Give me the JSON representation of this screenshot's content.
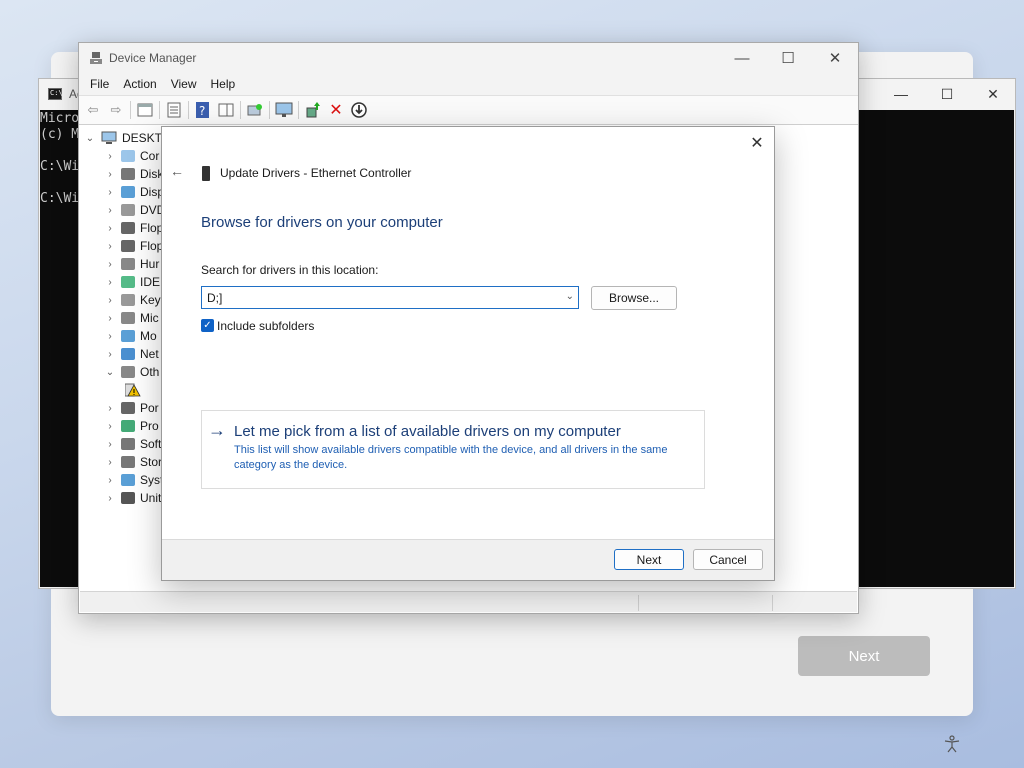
{
  "setup": {
    "next_label": "Next"
  },
  "console": {
    "title": "Ad",
    "lines": [
      "Micro",
      "(c) M",
      "",
      "C:\\Wi",
      "",
      "C:\\Wi"
    ],
    "controls": {
      "minimize": "—",
      "maximize": "☐",
      "close": "✕"
    }
  },
  "device_manager": {
    "title": "Device Manager",
    "controls": {
      "minimize": "—",
      "maximize": "☐",
      "close": "✕"
    },
    "menu": [
      "File",
      "Action",
      "View",
      "Help"
    ],
    "tree": {
      "root": "DESKTO",
      "items": [
        {
          "label": "Cor",
          "icon": "computer-icon",
          "expanded": false
        },
        {
          "label": "Disk",
          "icon": "disk-icon",
          "expanded": false
        },
        {
          "label": "Disp",
          "icon": "display-icon",
          "expanded": false
        },
        {
          "label": "DVD",
          "icon": "dvd-icon",
          "expanded": false
        },
        {
          "label": "Flop",
          "icon": "floppy-icon",
          "expanded": false
        },
        {
          "label": "Flop",
          "icon": "floppy-controller-icon",
          "expanded": false
        },
        {
          "label": "Hur",
          "icon": "hid-icon",
          "expanded": false
        },
        {
          "label": "IDE",
          "icon": "ide-icon",
          "expanded": false
        },
        {
          "label": "Key",
          "icon": "keyboard-icon",
          "expanded": false
        },
        {
          "label": "Mic",
          "icon": "mouse-icon",
          "expanded": false
        },
        {
          "label": "Mo",
          "icon": "monitor-icon",
          "expanded": false
        },
        {
          "label": "Net",
          "icon": "network-icon",
          "expanded": false
        },
        {
          "label": "Oth",
          "icon": "other-devices-icon",
          "expanded": true
        },
        {
          "label": "",
          "icon": "warning-device-icon",
          "expanded": null
        },
        {
          "label": "Por",
          "icon": "port-icon",
          "expanded": false
        },
        {
          "label": "Pro",
          "icon": "processor-icon",
          "expanded": false
        },
        {
          "label": "Soft",
          "icon": "software-icon",
          "expanded": false
        },
        {
          "label": "Stor",
          "icon": "storage-icon",
          "expanded": false
        },
        {
          "label": "Syst",
          "icon": "system-icon",
          "expanded": false
        },
        {
          "label": "Unit",
          "icon": "usb-icon",
          "expanded": false
        }
      ]
    }
  },
  "dialog": {
    "header_title": "Update Drivers - Ethernet Controller",
    "heading": "Browse for drivers on your computer",
    "location_label": "Search for drivers in this location:",
    "location_value": "D;]",
    "browse_label": "Browse...",
    "include_subfolders_label": "Include subfolders",
    "include_subfolders_checked": true,
    "pick_title": "Let me pick from a list of available drivers on my computer",
    "pick_description": "This list will show available drivers compatible with the device, and all drivers in the same category as the device.",
    "next_label": "Next",
    "cancel_label": "Cancel",
    "accent_color": "#1c3f78"
  }
}
